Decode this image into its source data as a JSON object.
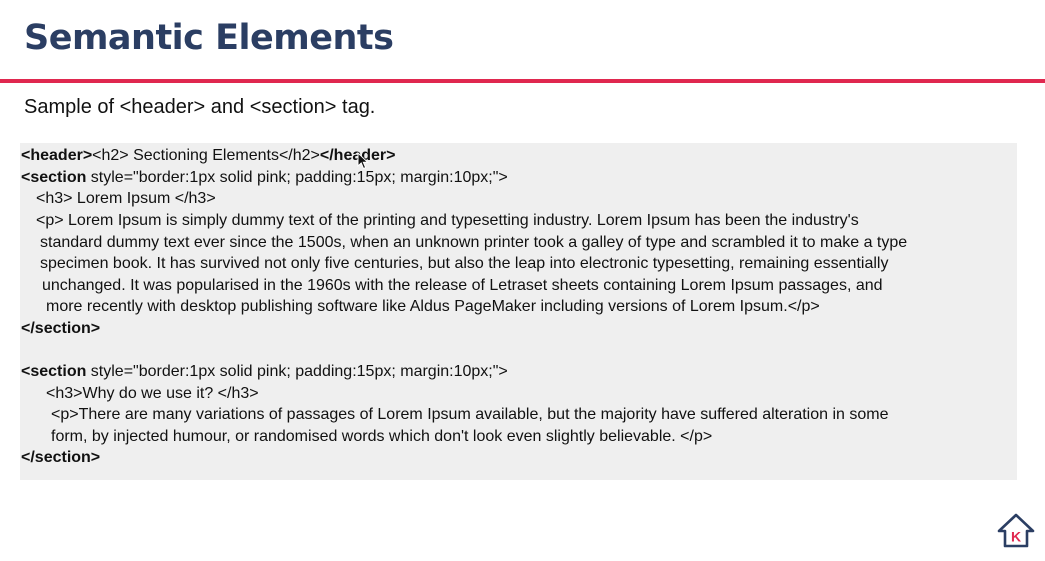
{
  "slide": {
    "title": "Semantic Elements",
    "subtitle": "Sample of <header> and <section> tag.",
    "accent_color": "#e0284f",
    "title_color": "#2b3e63"
  },
  "code": {
    "line1": {
      "t1": "<header>",
      "t2": "<h2> Sectioning Elements</h2>",
      "t3": "</header>"
    },
    "line2": {
      "t1": "<section",
      "t2": " style=\"border:1px solid pink;  padding:15px;  margin:10px;\">"
    },
    "line3": "<h3> Lorem Ipsum </h3>",
    "line4": "<p> Lorem Ipsum is simply dummy text of the printing and typesetting industry. Lorem Ipsum has been the industry's",
    "line5": "standard dummy text ever since the 1500s, when an unknown printer took a galley of type and scrambled it to make a type",
    "line6": "specimen book. It has survived not only five centuries, but also the leap into electronic typesetting, remaining essentially",
    "line7": "unchanged. It was popularised in the 1960s with the release of Letraset sheets containing Lorem Ipsum passages, and",
    "line8": "more recently with desktop publishing software like Aldus PageMaker including versions of Lorem Ipsum.</p>",
    "line9": "</section>",
    "line10": {
      "t1": "<section",
      "t2": " style=\"border:1px solid pink;  padding:15px;  margin:10px;\">"
    },
    "line11": "<h3>Why do we use it? </h3>",
    "line12": "<p>There are many variations of passages of Lorem Ipsum available, but the majority have suffered alteration in some",
    "line13": "form, by injected humour, or randomised words which don't look even slightly believable. </p>",
    "line14": "</section>"
  },
  "icons": {
    "cursor": "mouse-pointer-icon",
    "logo": "house-k-logo-icon",
    "logo_letter": "K"
  }
}
